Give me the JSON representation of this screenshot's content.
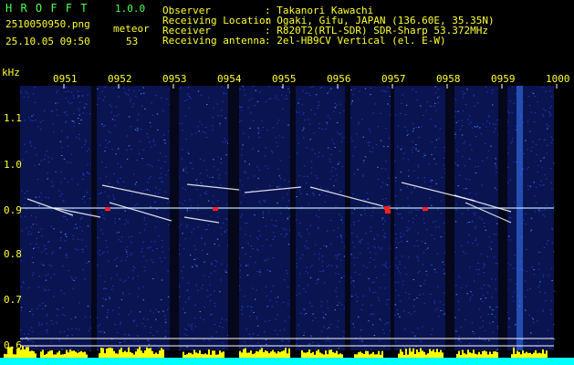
{
  "header": {
    "app_name": "H R O F F T",
    "version": "1.0.0",
    "filename": "2510050950.png",
    "datetime": "25.10.05 09:50",
    "meteor_label": "meteor",
    "meteor_count": "53",
    "info_labels": [
      "Observer",
      "Receiving Location",
      "Receiver",
      "Receiving antenna"
    ],
    "info_values": [
      ": Takanori Kawachi",
      ": Ogaki, Gifu, JAPAN (136.60E, 35.35N)",
      ": R820T2(RTL-SDR) SDR-Sharp 53.372MHz",
      ": 2el-HB9CV Vertical (el. E-W)"
    ]
  },
  "axis": {
    "unit": "kHz",
    "y_ticks": [
      "1.1",
      "1.0",
      "0.9",
      "0.8",
      "0.7",
      "0.6"
    ],
    "x_ticks": [
      "0951",
      "0952",
      "0953",
      "0954",
      "0955",
      "0956",
      "0957",
      "0958",
      "0959",
      "1000"
    ]
  },
  "colors": {
    "background": "#000000",
    "grid": "#ffffff",
    "echo_trace": "#ffffff",
    "strong_echo": "#ff2020",
    "noise_blue": "#1e3cd2",
    "level_fill": "#ffff00",
    "level_base": "#00ffff"
  }
}
